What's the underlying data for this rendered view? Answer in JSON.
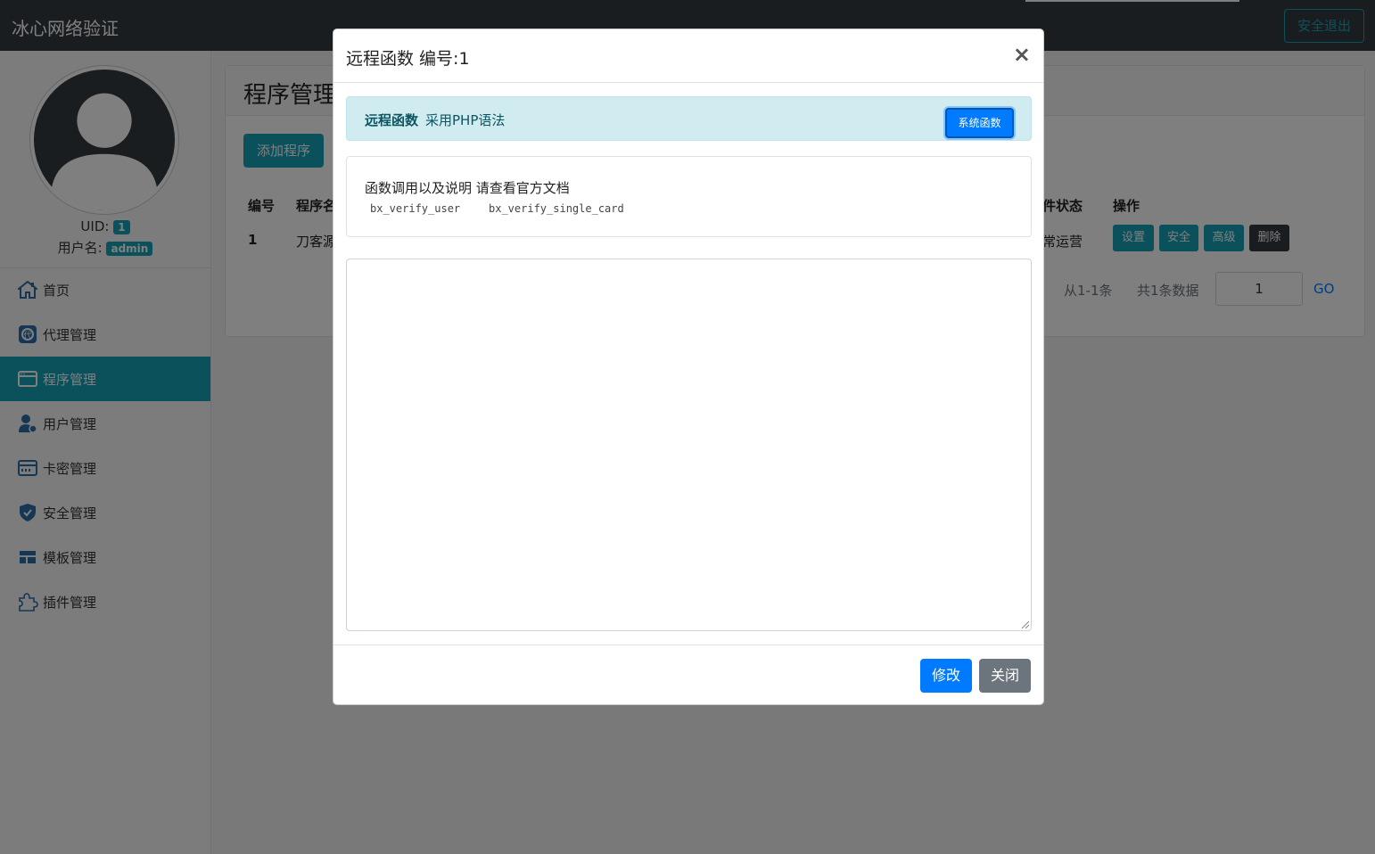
{
  "app": {
    "title": "冰心网络验证",
    "logout_label": "安全退出"
  },
  "sidebar": {
    "uid_label": "UID:",
    "uid_value": "1",
    "username_label": "用户名:",
    "username_value": "admin",
    "items": [
      {
        "label": "首页",
        "icon": "home-icon"
      },
      {
        "label": "代理管理",
        "icon": "agent-icon"
      },
      {
        "label": "程序管理",
        "icon": "program-icon",
        "active": true
      },
      {
        "label": "用户管理",
        "icon": "user-icon"
      },
      {
        "label": "卡密管理",
        "icon": "card-icon"
      },
      {
        "label": "安全管理",
        "icon": "shield-icon"
      },
      {
        "label": "模板管理",
        "icon": "template-icon"
      },
      {
        "label": "插件管理",
        "icon": "plugin-icon"
      }
    ]
  },
  "main": {
    "page_title": "程序管理",
    "add_button": "添加程序",
    "table": {
      "headers": {
        "id": "编号",
        "name": "程序名",
        "status": "件状态",
        "actions": "操作"
      },
      "rows": [
        {
          "id": "1",
          "name": "刀客源",
          "status": "常运营"
        }
      ],
      "row_actions": [
        "设置",
        "安全",
        "高级",
        "删除"
      ]
    },
    "pagination": {
      "range": "从1-1条",
      "total": "共1条数据",
      "page_value": "1",
      "go_label": "GO"
    }
  },
  "modal": {
    "title": "远程函数 编号:1",
    "close_symbol": "×",
    "alert_strong": "远程函数",
    "alert_text": "采用PHP语法",
    "system_func_button": "系统函数",
    "doc_text": "函数调用以及说明 请查看官方文档",
    "code_examples": [
      "bx_verify_user",
      "bx_verify_single_card"
    ],
    "editor_value": "",
    "save_button": "修改",
    "close_button": "关闭"
  },
  "colors": {
    "topbar": "#343a40",
    "info": "#17a2b8",
    "primary": "#007bff",
    "secondary": "#6c757d",
    "dark": "#343a40"
  }
}
